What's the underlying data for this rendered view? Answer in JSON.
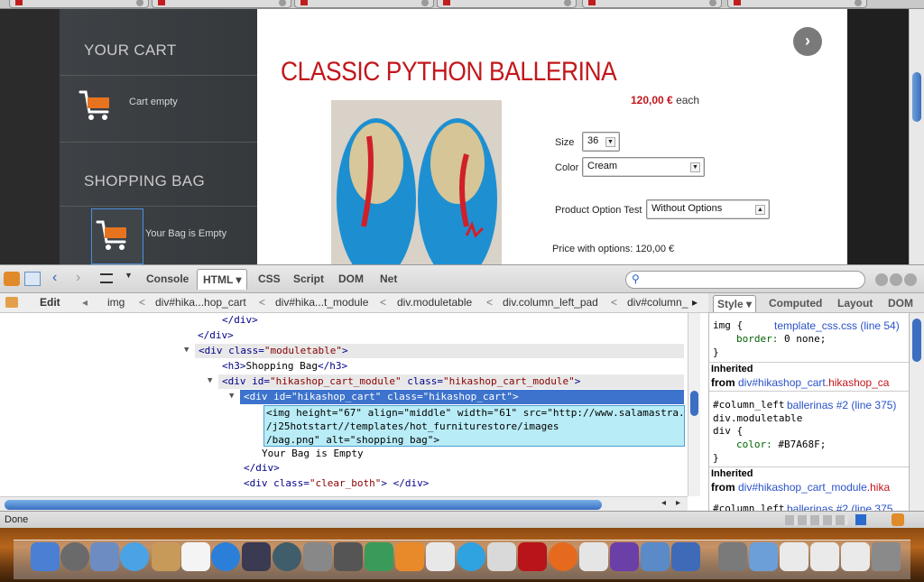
{
  "sidebar": {
    "your_cart_title": "YOUR CART",
    "cart_status": "Cart empty",
    "shopping_bag_title": "SHOPPING BAG",
    "bag_status": "Your Bag is Empty"
  },
  "product": {
    "title": "CLASSIC PYTHON BALLERINA",
    "price": "120,00 €",
    "price_suffix": "each",
    "size_label": "Size",
    "size_value": "36",
    "color_label": "Color",
    "color_value": "Cream",
    "option_label": "Product Option Test",
    "option_value": "Without Options",
    "price_with_options": "Price with options: 120,00 €",
    "next_glyph": "›"
  },
  "firebug": {
    "tabs": [
      "Console",
      "HTML",
      "CSS",
      "Script",
      "DOM",
      "Net"
    ],
    "edit_label": "Edit",
    "breadcrumbs": [
      "img",
      "div#hika...hop_cart",
      "div#hika...t_module",
      "div.moduletable",
      "div.column_left_pad",
      "div#column_l"
    ],
    "side_tabs": [
      "Style",
      "Computed",
      "Layout",
      "DOM"
    ],
    "html_lines": {
      "l1": "</div>",
      "l2": "</div>",
      "l3_open": "<div class=",
      "l3_val": "\"moduletable\"",
      "l3_close": ">",
      "l4": "<h3>",
      "l4_text": "Shopping Bag",
      "l4_end": "</h3>",
      "l5_a": "<div id=",
      "l5_v1": "\"hikashop_cart_module\"",
      "l5_b": " class=",
      "l5_v2": "\"hikashop_cart_module\"",
      "l5_c": ">",
      "l6": "<div id=\"hikashop_cart\" class=\"hikashop_cart\">",
      "img1": "<img height=\"67\" align=\"middle\" width=\"61\" src=\"http://www.salamastra.e",
      "img2": "/j25hotstart//templates/hot_furniturestore/images",
      "img3": "/bag.png\" alt=\"shopping bag\">",
      "text_empty": "Your Bag is Empty",
      "l_close": "</div>",
      "l_clear_a": "<div class=",
      "l_clear_v": "\"clear_both\"",
      "l_clear_b": "> </div>",
      "l_last": "</div>"
    },
    "styles": {
      "s1_sel": "img {",
      "s1_src": "template_css.css (line 54)",
      "s1_prop": "border:",
      "s1_val": "0 none;",
      "s1_end": "}",
      "inh1_label": "Inherited",
      "inh1_from": "from ",
      "inh1_el": "div#hikashop_cart",
      "inh1_cls": ".hikashop_ca",
      "s2_sel": "#column_left",
      "s2_src": "ballerinas #2 (line 375)",
      "s2_sel2": "div.moduletable",
      "s2_sel3": "div {",
      "s2_prop": "color:",
      "s2_val": "#B7A68F;",
      "s2_end": "}",
      "inh2_label": "Inherited",
      "inh2_from": "from ",
      "inh2_el": "div#hikashop_cart_module",
      "inh2_cls": ".hika",
      "s3_sel": "#column_left",
      "s3_src": "ballerinas #2 (line 375"
    },
    "status": "Done"
  },
  "colors": {
    "accent_red": "#c2171b",
    "selection_blue": "#3d73cc",
    "sidebar_bg": "#3a3e41"
  }
}
